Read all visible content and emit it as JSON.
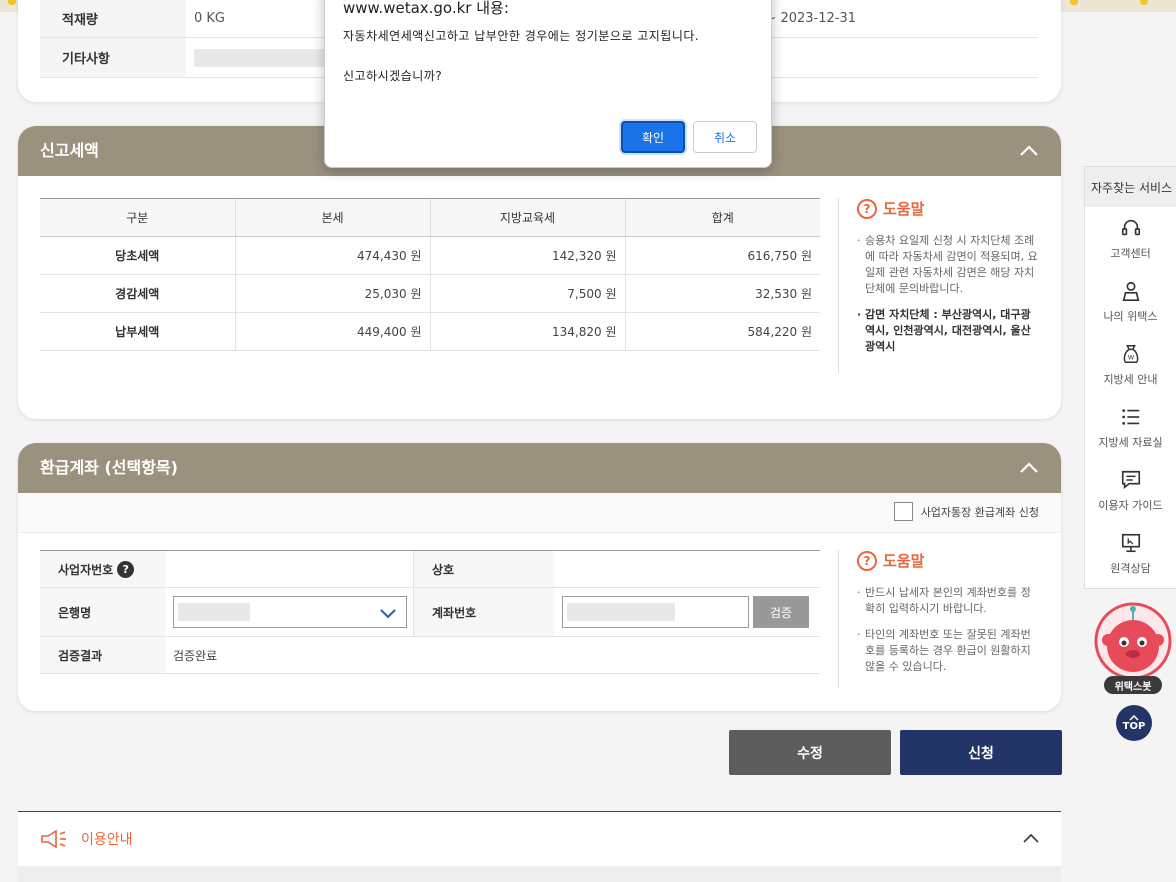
{
  "browser": {
    "alert_origin": "www.wetax.go.kr 내용:"
  },
  "dialog": {
    "message_line1": "자동차세연세액신고하고 납부안한 경우에는 정기분으로 고지됩니다.",
    "message_line2": "신고하시겠습니까?",
    "ok_label": "확인",
    "cancel_label": "취소"
  },
  "vehicle_info": {
    "load_label": "적재량",
    "load_value": "0 KG",
    "period_tail": "1 ~ 2023-12-31",
    "other_label": "기타사항"
  },
  "tax_section": {
    "title": "신고세액",
    "headers": [
      "구분",
      "본세",
      "지방교육세",
      "합계"
    ],
    "rows": [
      {
        "label": "당초세액",
        "main": "474,430 원",
        "edu": "142,320 원",
        "total": "616,750 원"
      },
      {
        "label": "경감세액",
        "main": "25,030 원",
        "edu": "7,500 원",
        "total": "32,530 원"
      },
      {
        "label": "납부세액",
        "main": "449,400 원",
        "edu": "134,820 원",
        "total": "584,220 원"
      }
    ],
    "help_title": "도움말",
    "help_items": [
      "승용차 요일제 신청 시 자치단체 조례에 따라 자동차세 감면이 적용되며, 요일제 관련 자동차세 감면은 해당 자치단체에 문의바랍니다.",
      "감면 자치단체 : 부산광역시, 대구광역시, 인천광역시, 대전광역시, 울산광역시"
    ]
  },
  "refund_section": {
    "title": "환급계좌 (선택항목)",
    "business_checkbox_label": "사업자통장 환급계좌 신청",
    "biz_no_label": "사업자번호",
    "company_label": "상호",
    "bank_label": "은행명",
    "account_label": "계좌번호",
    "verify_button": "검증",
    "result_label": "검증결과",
    "result_value": "검증완료",
    "help_title": "도움말",
    "help_items": [
      "반드시 납세자 본인의 계좌번호를 정확히 입력하시기 바랍니다.",
      "타인의 계좌번호 또는 잘못된 계좌번호를 등록하는 경우 환급이 원활하지 않을 수 있습니다."
    ]
  },
  "actions": {
    "edit_label": "수정",
    "submit_label": "신청"
  },
  "usage_guide": {
    "title": "이용안내"
  },
  "sidebar": {
    "title": "자주찾는 서비스",
    "items": [
      "고객센터",
      "나의 위택스",
      "지방세 안내",
      "지방세 자료실",
      "이용자 가이드",
      "원격상담"
    ]
  },
  "chatbot": {
    "label": "위택스봇"
  },
  "top_button": {
    "label": "TOP"
  },
  "colors": {
    "header_brown": "#9b917f",
    "submit_navy": "#233567",
    "edit_gray": "#5d5d5d",
    "help_orange": "#e8663a",
    "ok_blue": "#1a73e8"
  }
}
